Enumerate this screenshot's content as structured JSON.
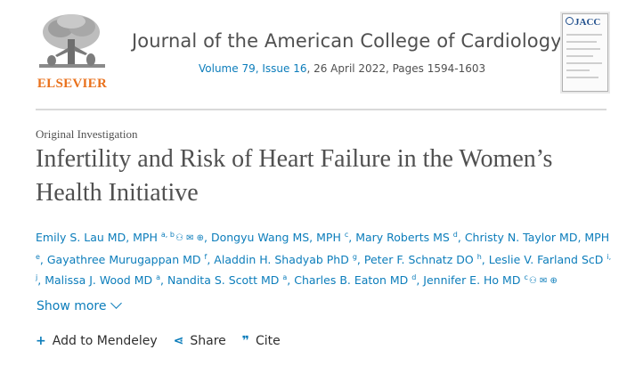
{
  "publisher": {
    "name": "ELSEVIER"
  },
  "journal": {
    "title": "Journal of the American College of Cardiology",
    "volume_issue": "Volume 79, Issue 16",
    "date_pages": ", 26 April 2022, Pages 1594-1603",
    "cover_label": "JACC"
  },
  "article": {
    "type": "Original Investigation",
    "title": "Infertility and Risk of Heart Failure in the Women’s Health Initiative"
  },
  "authors": [
    {
      "name": "Emily S. Lau MD, MPH",
      "sup": "a, b",
      "icons": true
    },
    {
      "name": "Dongyu Wang MS, MPH",
      "sup": "c"
    },
    {
      "name": "Mary Roberts MS",
      "sup": "d"
    },
    {
      "name": "Christy N. Taylor MD, MPH",
      "sup": "e"
    },
    {
      "name": "Gayathree Murugappan MD",
      "sup": "f"
    },
    {
      "name": "Aladdin H. Shadyab PhD",
      "sup": "g"
    },
    {
      "name": "Peter F. Schnatz DO",
      "sup": "h"
    },
    {
      "name": "Leslie V. Farland ScD",
      "sup": "i, j"
    },
    {
      "name": "Malissa J. Wood MD",
      "sup": "a"
    },
    {
      "name": "Nandita S. Scott MD",
      "sup": "a"
    },
    {
      "name": "Charles B. Eaton MD",
      "sup": "d"
    },
    {
      "name": "Jennifer E. Ho MD",
      "sup": "c",
      "icons": true
    }
  ],
  "show_more": "Show more",
  "actions": [
    {
      "icon": "plus-icon",
      "glyph": "+",
      "label": "Add to Mendeley"
    },
    {
      "icon": "share-icon",
      "glyph": "⋖",
      "label": "Share"
    },
    {
      "icon": "quote-icon",
      "glyph": "❞",
      "label": "Cite"
    }
  ],
  "colors": {
    "link": "#0c7dbb",
    "publisher": "#e9711c",
    "text": "#505050"
  }
}
